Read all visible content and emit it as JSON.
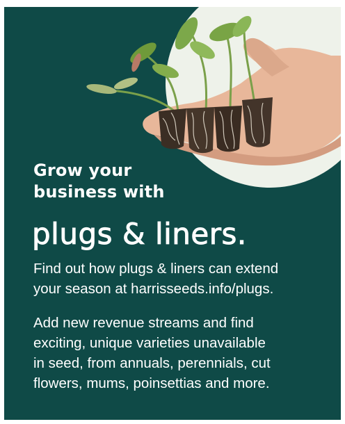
{
  "ad": {
    "background_color": "#0f4a47",
    "accent_color": "#f1f4ee",
    "photo_icon": "hand-holding-plug-seedlings",
    "headline_small": {
      "line1": "Grow your",
      "line2": "business with"
    },
    "headline_large": "plugs & liners.",
    "paragraph1": {
      "line1": "Find out how plugs & liners can extend",
      "line2": "your season at harrisseeds.info/plugs."
    },
    "paragraph2": {
      "line1": "Add new revenue streams and find",
      "line2": "exciting, unique varieties unavailable",
      "line3": "in seed, from annuals, perennials, cut",
      "line4": "flowers, mums, poinsettias and more."
    }
  }
}
